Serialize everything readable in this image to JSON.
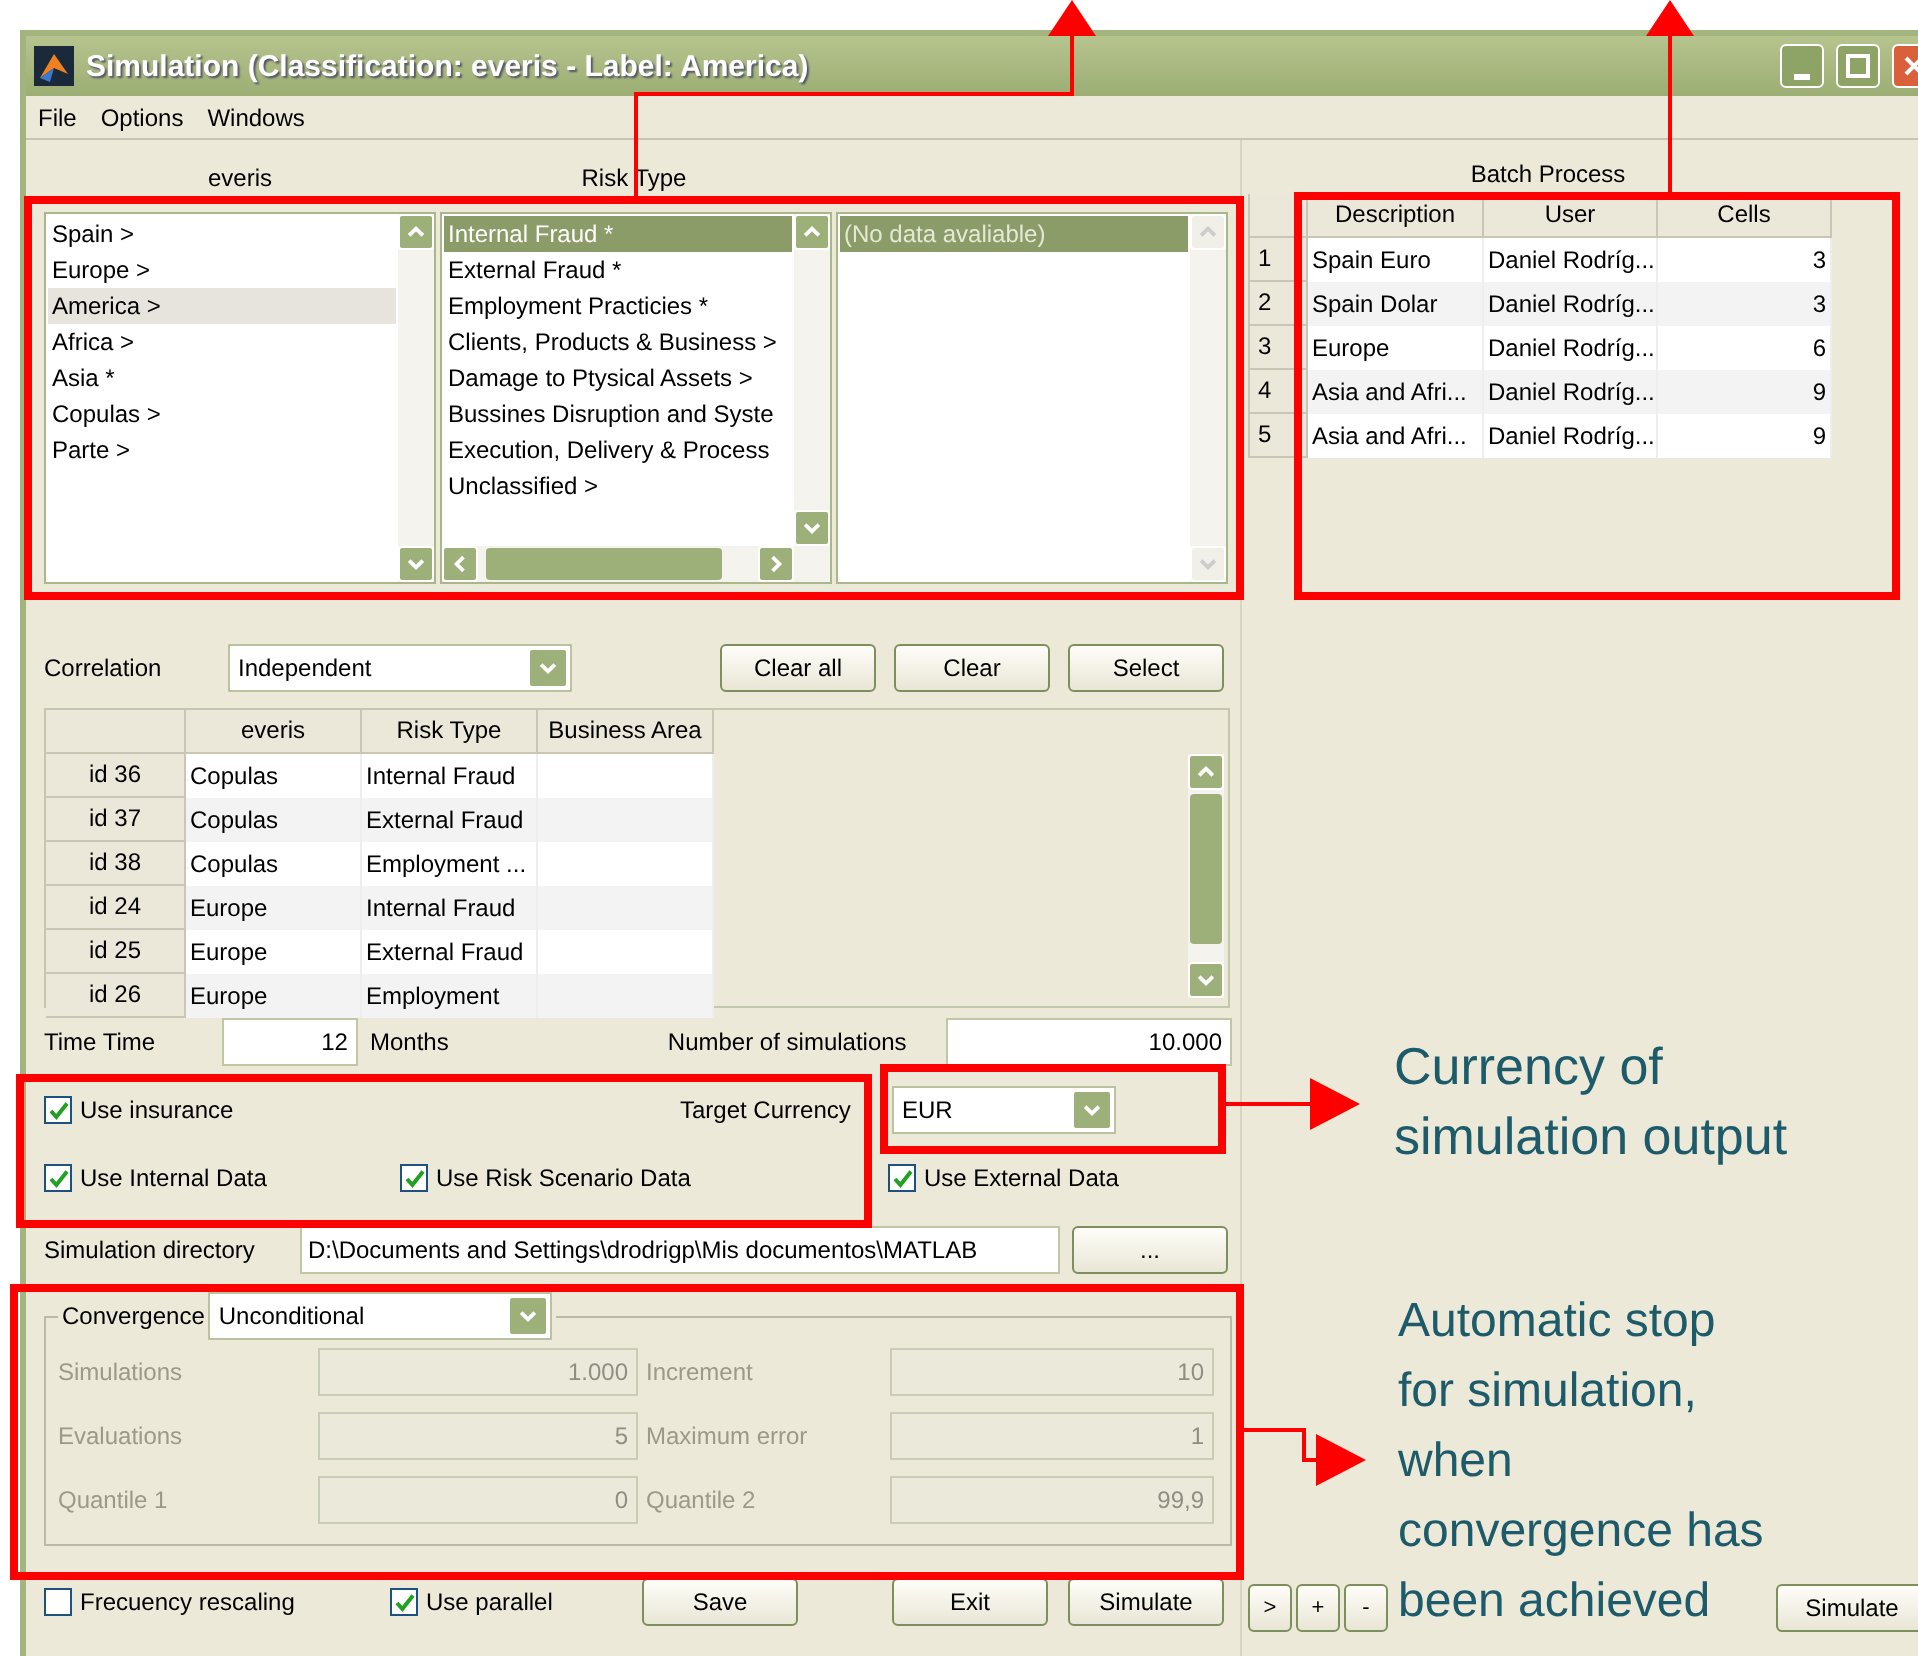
{
  "window": {
    "title": "Simulation (Classification: everis - Label: America)"
  },
  "menu": [
    "File",
    "Options",
    "Windows"
  ],
  "selector": {
    "headers": [
      "everis",
      "Risk Type"
    ],
    "lists": [
      {
        "focused": false,
        "hscroll": false,
        "items": [
          {
            "label": "Spain >",
            "selected": false
          },
          {
            "label": "Europe >",
            "selected": false
          },
          {
            "label": "America >",
            "selected": true
          },
          {
            "label": "Africa >",
            "selected": false
          },
          {
            "label": "Asia *",
            "selected": false
          },
          {
            "label": "Copulas >",
            "selected": false
          },
          {
            "label": "Parte >",
            "selected": false
          }
        ]
      },
      {
        "focused": true,
        "hscroll": true,
        "items": [
          {
            "label": "Internal Fraud *",
            "selected": true
          },
          {
            "label": "External Fraud *",
            "selected": false
          },
          {
            "label": "Employment Practicies *",
            "selected": false
          },
          {
            "label": "Clients, Products & Business >",
            "selected": false
          },
          {
            "label": "Damage to Ptysical Assets >",
            "selected": false
          },
          {
            "label": "Bussines Disruption and Syste",
            "selected": false
          },
          {
            "label": "Execution, Delivery & Process",
            "selected": false
          },
          {
            "label": "Unclassified >",
            "selected": false
          }
        ]
      },
      {
        "focused": true,
        "hscroll": false,
        "disabled": true,
        "items": [
          {
            "label": "(No data avaliable)",
            "selected": true
          }
        ]
      }
    ]
  },
  "correlation": {
    "label": "Correlation",
    "value": "Independent",
    "buttons": [
      "Clear all",
      "Clear",
      "Select"
    ]
  },
  "correlation_table": {
    "columns": [
      "everis",
      "Risk Type",
      "Business Area"
    ],
    "rows": [
      {
        "id": "id 36",
        "cells": [
          "Copulas",
          "Internal Fraud"
        ]
      },
      {
        "id": "id 37",
        "cells": [
          "Copulas",
          "External Fraud"
        ]
      },
      {
        "id": "id 38",
        "cells": [
          "Copulas",
          "Employment ..."
        ]
      },
      {
        "id": "id 24",
        "cells": [
          "Europe",
          "Internal Fraud"
        ]
      },
      {
        "id": "id 25",
        "cells": [
          "Europe",
          "External Fraud"
        ]
      },
      {
        "id": "id 26",
        "cells": [
          "Europe",
          "Employment"
        ]
      }
    ]
  },
  "time": {
    "label": "Time Time",
    "value": "12",
    "unit": "Months"
  },
  "simulations": {
    "label": "Number of simulations",
    "value": "10.000"
  },
  "options": [
    {
      "label": "Use insurance",
      "checked": true
    },
    {
      "label": "Use Internal Data",
      "checked": true
    },
    {
      "label": "Use Risk Scenario Data",
      "checked": true
    },
    {
      "label": "Use External Data",
      "checked": true
    }
  ],
  "target_currency": {
    "label": "Target Currency",
    "value": "EUR"
  },
  "directory": {
    "label": "Simulation directory",
    "value": "D:\\Documents and Settings\\drodrigp\\Mis documentos\\MATLAB",
    "browse": "..."
  },
  "convergence": {
    "label": "Convergence",
    "value": "Unconditional",
    "fields": [
      {
        "label": "Simulations",
        "value": "1.000",
        "disabled": true
      },
      {
        "label": "Increment",
        "value": "10",
        "disabled": true
      },
      {
        "label": "Evaluations",
        "value": "5",
        "disabled": true
      },
      {
        "label": "Maximum error",
        "value": "1",
        "disabled": true
      },
      {
        "label": "Quantile 1",
        "value": "0",
        "disabled": true
      },
      {
        "label": "Quantile 2",
        "value": "99,9",
        "disabled": true
      }
    ]
  },
  "bottom": {
    "options": [
      {
        "label": "Frecuency rescaling",
        "checked": false
      },
      {
        "label": "Use parallel",
        "checked": true
      }
    ],
    "buttons": [
      "Save",
      "Exit",
      "Simulate"
    ]
  },
  "batch": {
    "title": "Batch Process",
    "columns": [
      "Description",
      "User",
      "Cells"
    ],
    "rows": [
      {
        "index": "1",
        "cells": [
          "Spain Euro",
          "Daniel Rodríg...",
          "3"
        ]
      },
      {
        "index": "2",
        "cells": [
          "Spain Dolar",
          "Daniel Rodríg...",
          "3"
        ]
      },
      {
        "index": "3",
        "cells": [
          "Europe",
          "Daniel Rodríg...",
          "6"
        ]
      },
      {
        "index": "4",
        "cells": [
          "Asia and Afri...",
          "Daniel Rodríg...",
          "9"
        ]
      },
      {
        "index": "5",
        "cells": [
          "Asia and Afri...",
          "Daniel Rodríg...",
          "9"
        ]
      }
    ],
    "buttons": [
      ">",
      "+",
      "-"
    ],
    "simulate": "Simulate"
  },
  "annotations": [
    {
      "text": "Currency of simulation output"
    },
    {
      "text": "Automatic stop for simulation, when convergence has been achieved"
    }
  ]
}
